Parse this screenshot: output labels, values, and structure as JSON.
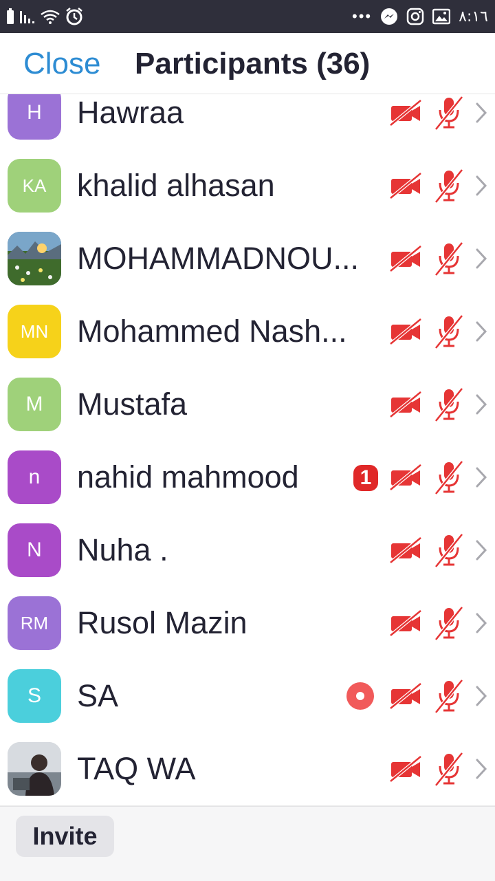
{
  "status_bar": {
    "time": "٨:١٦",
    "more_dots": "•••",
    "icons": [
      "battery-icon",
      "signal-icon",
      "wifi-icon",
      "alarm-icon",
      "messenger-icon",
      "instagram-icon",
      "gallery-icon"
    ]
  },
  "header": {
    "close_label": "Close",
    "title": "Participants (36)"
  },
  "participants": [
    {
      "initials": "H",
      "name": "Hawraa",
      "avatar_color": "#9b72d6",
      "avatar_type": "initials",
      "badge": "",
      "recording": false
    },
    {
      "initials": "KA",
      "name": "khalid alhasan",
      "avatar_color": "#9fd17a",
      "avatar_type": "initials",
      "badge": "",
      "recording": false
    },
    {
      "initials": "",
      "name": "MOHAMMADNOU...",
      "avatar_color": "#4a6b8a",
      "avatar_type": "photo-landscape",
      "badge": "",
      "recording": false
    },
    {
      "initials": "MN",
      "name": "Mohammed Nash...",
      "avatar_color": "#f6d21a",
      "avatar_type": "initials",
      "badge": "",
      "recording": false
    },
    {
      "initials": "M",
      "name": "Mustafa",
      "avatar_color": "#9fd17a",
      "avatar_type": "initials",
      "badge": "",
      "recording": false
    },
    {
      "initials": "n",
      "name": "nahid mahmood",
      "avatar_color": "#a94bc8",
      "avatar_type": "initials",
      "badge": "1",
      "recording": false
    },
    {
      "initials": "N",
      "name": "Nuha .",
      "avatar_color": "#a94bc8",
      "avatar_type": "initials",
      "badge": "",
      "recording": false
    },
    {
      "initials": "RM",
      "name": "Rusol Mazin",
      "avatar_color": "#9b72d6",
      "avatar_type": "initials",
      "badge": "",
      "recording": false
    },
    {
      "initials": "S",
      "name": "SA",
      "avatar_color": "#4bcfdc",
      "avatar_type": "initials",
      "badge": "",
      "recording": true
    },
    {
      "initials": "",
      "name": "TAQ WA",
      "avatar_color": "#c7c9cc",
      "avatar_type": "photo-person",
      "badge": "",
      "recording": false
    }
  ],
  "colors": {
    "accent": "#2d8cd3",
    "muted_red": "#e63535",
    "text": "#232333"
  },
  "footer": {
    "invite_label": "Invite"
  }
}
